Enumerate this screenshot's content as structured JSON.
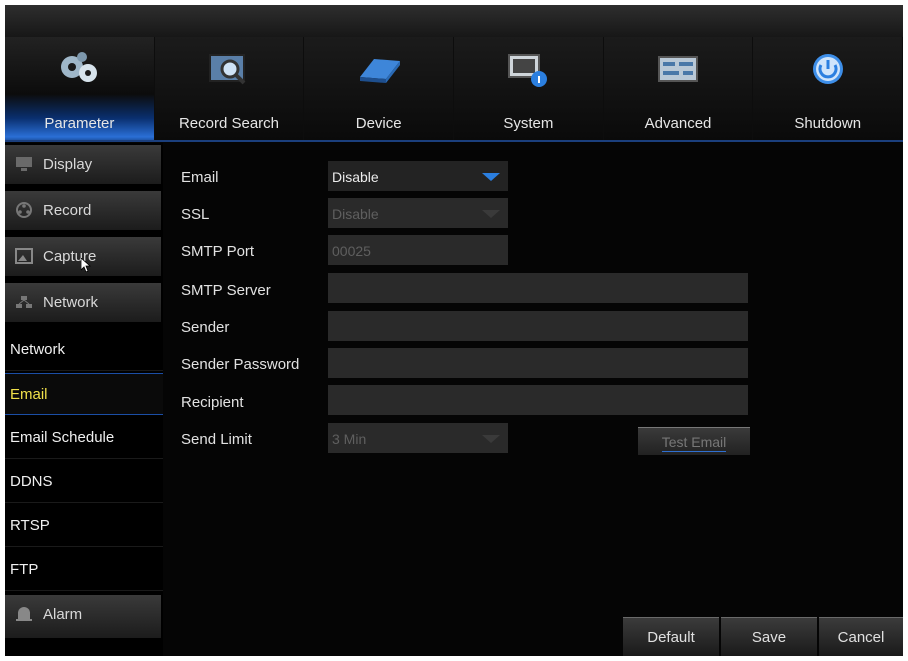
{
  "nav": {
    "tabs": [
      {
        "label": "Parameter",
        "icon": "gears-icon",
        "active": true
      },
      {
        "label": "Record Search",
        "icon": "magnifier-screen-icon",
        "active": false
      },
      {
        "label": "Device",
        "icon": "hard-drive-icon",
        "active": false
      },
      {
        "label": "System",
        "icon": "monitor-info-icon",
        "active": false
      },
      {
        "label": "Advanced",
        "icon": "sliders-panel-icon",
        "active": false
      },
      {
        "label": "Shutdown",
        "icon": "power-icon",
        "active": false
      }
    ]
  },
  "sidebar": {
    "categories": [
      {
        "label": "Display",
        "icon": "monitor-icon"
      },
      {
        "label": "Record",
        "icon": "film-reel-icon"
      },
      {
        "label": "Capture",
        "icon": "photo-icon"
      },
      {
        "label": "Network",
        "icon": "network-icon"
      },
      {
        "label": "Alarm",
        "icon": "alarm-bell-icon"
      }
    ],
    "network_items": [
      {
        "label": "Network",
        "active": false
      },
      {
        "label": "Email",
        "active": true
      },
      {
        "label": "Email Schedule",
        "active": false
      },
      {
        "label": "DDNS",
        "active": false
      },
      {
        "label": "RTSP",
        "active": false
      },
      {
        "label": "FTP",
        "active": false
      }
    ]
  },
  "form": {
    "email": {
      "label": "Email",
      "value": "Disable"
    },
    "ssl": {
      "label": "SSL",
      "value": "Disable"
    },
    "smtp_port": {
      "label": "SMTP Port",
      "value": "00025"
    },
    "smtp_server": {
      "label": "SMTP Server",
      "value": ""
    },
    "sender": {
      "label": "Sender",
      "value": ""
    },
    "sender_password": {
      "label": "Sender Password",
      "value": ""
    },
    "recipient": {
      "label": "Recipient",
      "value": ""
    },
    "send_limit": {
      "label": "Send Limit",
      "value": "3 Min"
    },
    "test_email_label": "Test Email"
  },
  "buttons": {
    "default": "Default",
    "save": "Save",
    "cancel": "Cancel"
  },
  "colors": {
    "accent_blue": "#2b7fe0",
    "active_item_text": "#f0e04a"
  }
}
